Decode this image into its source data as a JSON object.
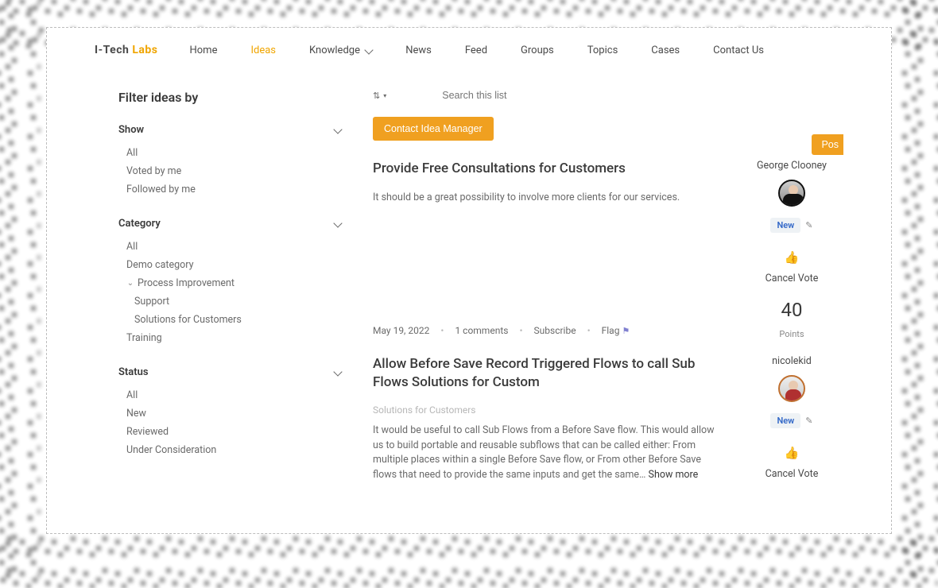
{
  "logo": {
    "text1": "I-Tech",
    "text2": "Labs"
  },
  "nav": {
    "items": [
      {
        "label": "Home"
      },
      {
        "label": "Ideas",
        "active": true
      },
      {
        "label": "Knowledge",
        "dropdown": true
      },
      {
        "label": "News"
      },
      {
        "label": "Feed"
      },
      {
        "label": "Groups"
      },
      {
        "label": "Topics"
      },
      {
        "label": "Cases"
      },
      {
        "label": "Contact Us"
      }
    ]
  },
  "filters": {
    "title": "Filter ideas by",
    "show": {
      "label": "Show",
      "items": [
        "All",
        "Voted by me",
        "Followed by me"
      ]
    },
    "category": {
      "label": "Category",
      "items": [
        "All",
        "Demo category"
      ],
      "expanded_label": "Process Improvement",
      "expanded_items": [
        "Support",
        "Solutions for Customers"
      ],
      "after": [
        "Training"
      ]
    },
    "status": {
      "label": "Status",
      "items": [
        "All",
        "New",
        "Reviewed",
        "Under Consideration"
      ]
    }
  },
  "toolbar": {
    "search_placeholder": "Search this list",
    "contact_btn": "Contact Idea Manager",
    "post_btn": "Pos"
  },
  "ideas": [
    {
      "title": "Provide Free Consultations for Customers",
      "desc": "It should be a great possibility to involve more clients for our services.",
      "date": "May 19, 2022",
      "comments": "1 comments",
      "subscribe": "Subscribe",
      "flag": "Flag",
      "author": "George Clooney",
      "status": "New",
      "cancel": "Cancel Vote",
      "points": "40",
      "points_label": "Points"
    },
    {
      "title": "Allow Before Save Record Triggered Flows to call Sub Flows Solutions for Custom",
      "subcat": "Solutions for Customers",
      "desc": "It would be useful to call Sub Flows from a Before Save flow. This would allow us to build portable and reusable subflows that can be called either: From multiple places within a single Before Save flow, or From other Before Save flows that need to provide the same inputs and get the same…",
      "show_more": "Show more",
      "author": "nicolekid",
      "status": "New",
      "cancel": "Cancel Vote"
    }
  ]
}
